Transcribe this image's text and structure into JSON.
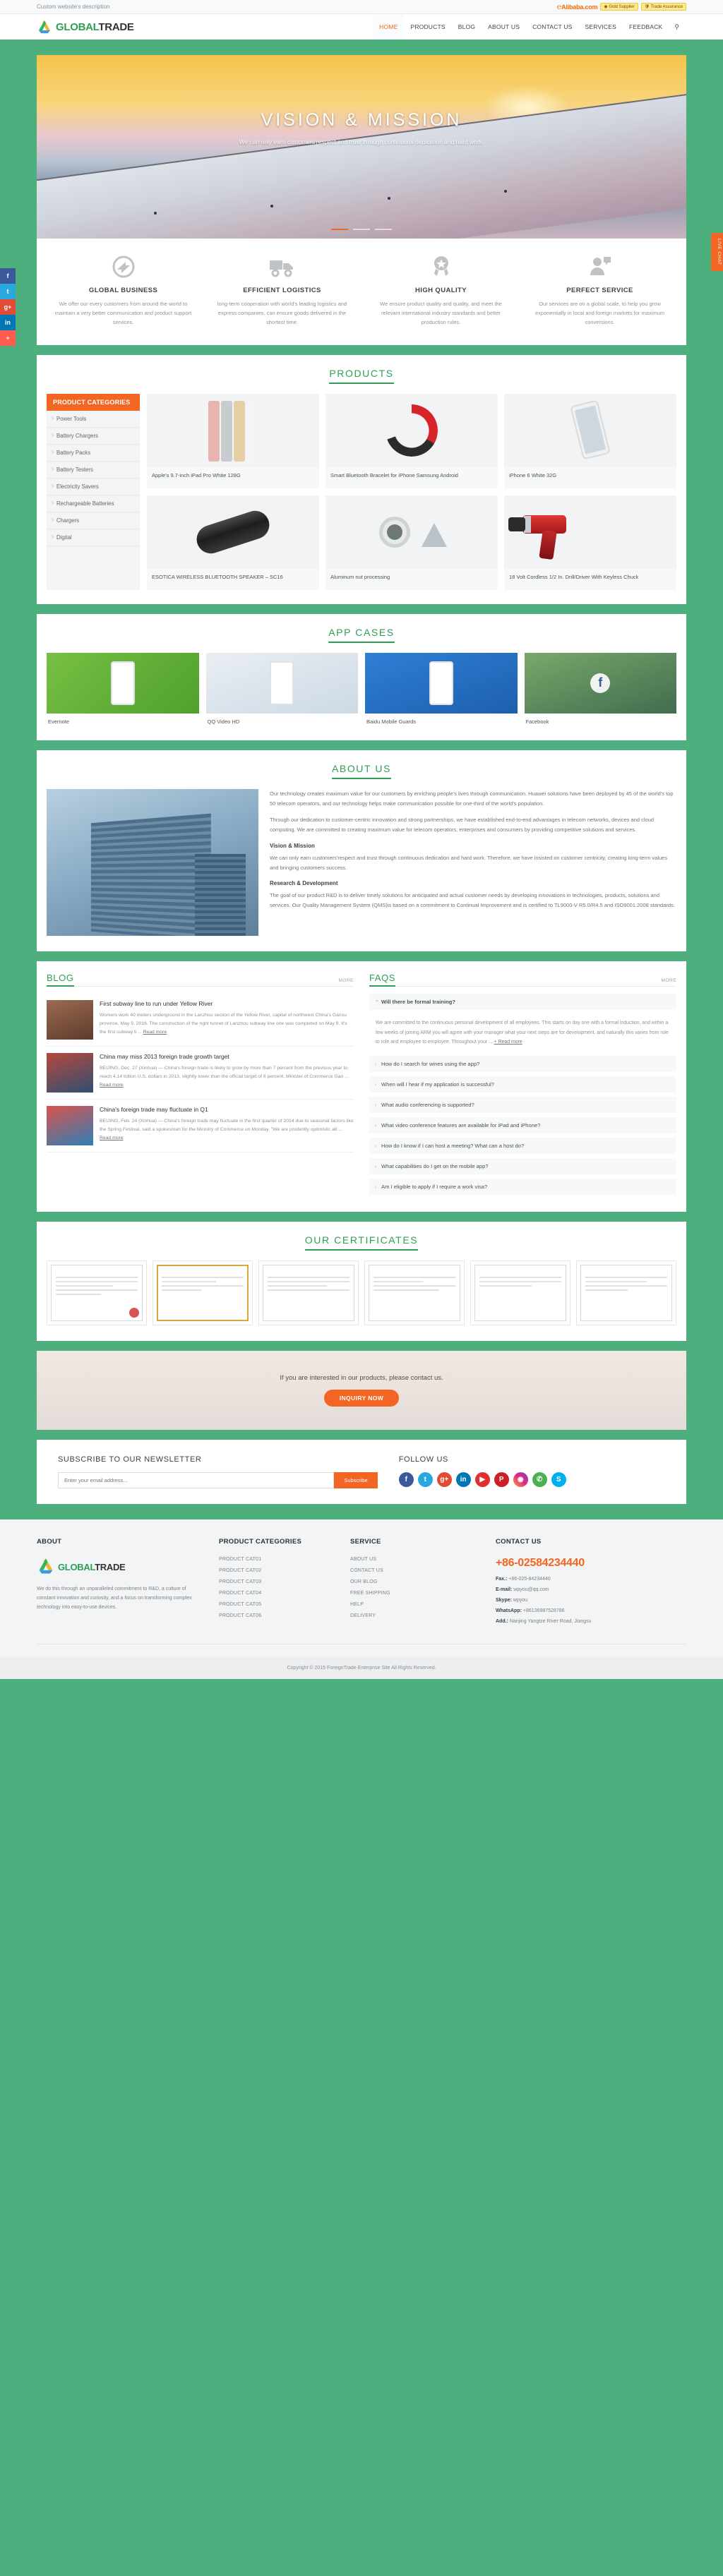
{
  "topbar": {
    "description": "Custom website's description",
    "alibaba_label": "Alibaba.com",
    "gold_supplier": "Gold Supplier",
    "trade_assurance": "Trade Assurance"
  },
  "header": {
    "logo_first": "GLOBAL",
    "logo_second": "TRADE",
    "nav": [
      {
        "label": "HOME",
        "active": true
      },
      {
        "label": "PRODUCTS",
        "active": false
      },
      {
        "label": "BLOG",
        "active": false
      },
      {
        "label": "ABOUT US",
        "active": false
      },
      {
        "label": "CONTACT US",
        "active": false
      },
      {
        "label": "SERVICES",
        "active": false
      },
      {
        "label": "FEEDBACK",
        "active": false
      }
    ],
    "search_icon": "⚲"
  },
  "social_rail": [
    {
      "name": "facebook",
      "glyph": "f"
    },
    {
      "name": "twitter",
      "glyph": "t"
    },
    {
      "name": "google-plus",
      "glyph": "g+"
    },
    {
      "name": "linkedin",
      "glyph": "in"
    },
    {
      "name": "more",
      "glyph": "+"
    }
  ],
  "live_chat": "LIVE CHAT",
  "hero": {
    "title": "VISION & MISSION",
    "subtitle": "We can only earn customers'respect and trust through continuous dedication and hard work."
  },
  "features": [
    {
      "icon": "globe-arrow-icon",
      "title": "GLOBAL BUSINESS",
      "text": "We offer our every customers from around the world to maintain a very better communication and product support services."
    },
    {
      "icon": "delivery-truck-icon",
      "title": "EFFICIENT LOGISTICS",
      "text": "long-term cooperation with world's leading logistics and express companies, can ensure goods delivered in the shortest time."
    },
    {
      "icon": "award-badge-icon",
      "title": "HIGH QUALITY",
      "text": "We ensure product quality and quality, and meet the relevant international industry standards and better production rules."
    },
    {
      "icon": "support-agent-icon",
      "title": "PERFECT SERVICE",
      "text": "Our services are on a global scale, to help you grow exponentially in local and foreign markets for maximum conversions."
    }
  ],
  "products": {
    "section_title": "PRODUCTS",
    "categories_title": "PRODUCT CATEGORIES",
    "categories": [
      "Power Tools",
      "Battery Chargers",
      "Battery Packs",
      "Battery Testers",
      "Electricity Savers",
      "Rechargeable Batteries",
      "Chargers",
      "Digital"
    ],
    "items": [
      {
        "name": "Apple's 9.7-inch iPad Pro White 128G",
        "art": "ipads"
      },
      {
        "name": "Smart Bluetooth Bracelet for iPhone Samsung Android",
        "art": "bracelet"
      },
      {
        "name": "iPhone 6 White 32G",
        "art": "iphone"
      },
      {
        "name": "ESOTICA WIRELESS BLUETOOTH SPEAKER – SC16",
        "art": "speaker"
      },
      {
        "name": "Aluminum nut processing",
        "art": "nut"
      },
      {
        "name": "18 Volt Cordless 1/2 In. Drill/Driver With Keyless Chuck",
        "art": "drill"
      }
    ]
  },
  "app_cases": {
    "section_title": "APP CASES",
    "items": [
      {
        "name": "Evernote",
        "art": "c1"
      },
      {
        "name": "QQ Video HD",
        "art": "c2"
      },
      {
        "name": "Baidu Mobile Guards",
        "art": "c3"
      },
      {
        "name": "Facebook",
        "art": "c4"
      }
    ]
  },
  "about": {
    "section_title": "ABOUT US",
    "p1": "Our technology creates maximum value for our customers by enriching people's lives through communication. Huawei solutions have been deployed by 45 of the world's top 50 telecom operators, and our technology helps make communication possible for one-third of the world's population.",
    "p2": "Through our dedication to customer-centric innovation and strong partnerships, we have established end-to-end advantages in telecom networks, devices and cloud computing. We are committed to creating maximum value for telecom operators, enterprises and consumers by providing competitive solutions and services.",
    "h1": "Vision & Mission",
    "p3": "We can only earn customers'respect and trust through continuous dedication and hard work. Therefore, we have insisted on customer centricity, creating long-term values and bringing customers success.",
    "h2": "Research & Development",
    "p4": "The goal of our product R&D is to deliver timely solutions for anticipated and actual customer needs by developing innovations in technologies, products, solutions and services. Our Quality Management System (QMS)is based on a commitment to Continual Improvement and is certified to TL9000-V R5.0/R4.5 and ISO9001:2008 standards."
  },
  "blog": {
    "title": "BLOG",
    "more": "MORE",
    "read_more": "Read more",
    "items": [
      {
        "title": "First subway line to run under Yellow River",
        "excerpt": "Workers work 40 meters underground in the Lanzhou section of the Yellow River, capital of northwest China's Gansu province, May 9, 2016. The construction of the right tunnel of Lanzhou subway line one was completed on May 9. It's the first subway li ...",
        "art": "bt1"
      },
      {
        "title": "China may miss 2013 foreign trade growth target",
        "excerpt": "BEIJING, Dec. 27 (Xinhua) — China's foreign trade is likely to grow by more than 7 percent from the previous year to reach 4.14 trillion U.S. dollars in 2013, slightly lower than the official target of 8 percent. Minister of Commerce Gao ...",
        "art": "bt2"
      },
      {
        "title": "China's foreign trade may fluctuate in Q1",
        "excerpt": "BEIJING, Feb. 24 (Xinhua) — China's foreign trade may fluctuate in the first quarter of 2014 due to seasonal factors like the Spring Festival, said a spokesman for the Ministry of Commerce on Monday. \"We are prudently optimistic ab ...",
        "art": "bt3"
      }
    ]
  },
  "faqs": {
    "title": "FAQS",
    "more": "MORE",
    "read_more": "+ Read more",
    "open_question": "Will there be formal training?",
    "open_answer": "We are committed to the continuous personal development of all employees. This starts on day one with a formal induction, and within a few weeks of joining ARM you will agree with your manager what your next steps are for development, and naturally this varies from role to role and employee to employee. Throughout your ...",
    "items": [
      "How do I search for wines using the app?",
      "When will I hear if my application is successful?",
      "What audio conferencing is supported?",
      "What video conference features are available for iPad and iPhone?",
      "How do I know if I can host a meeting? What can a host do?",
      "What capabilities do I get on the mobile app?",
      "Am I eligible to apply if I require a work visa?"
    ]
  },
  "certificates": {
    "section_title": "OUR CERTIFICATES",
    "items": [
      {
        "label": "certificate-1"
      },
      {
        "label": "certificate-2"
      },
      {
        "label": "certificate-3"
      },
      {
        "label": "certificate-4"
      },
      {
        "label": "certificate-5"
      },
      {
        "label": "certificate-6"
      }
    ]
  },
  "cta": {
    "text": "If you are interested in our products, please contact us.",
    "button": "INQUIRY NOW"
  },
  "newsletter": {
    "title": "SUBSCRIBE TO OUR NEWSLETTER",
    "placeholder": "Enter your email address...",
    "button": "Subscribe",
    "follow_title": "FOLLOW US",
    "socials": [
      {
        "name": "facebook",
        "glyph": "f",
        "cls": "s-fb"
      },
      {
        "name": "twitter",
        "glyph": "t",
        "cls": "s-tw"
      },
      {
        "name": "google-plus",
        "glyph": "g+",
        "cls": "s-gp"
      },
      {
        "name": "linkedin",
        "glyph": "in",
        "cls": "s-in"
      },
      {
        "name": "youtube",
        "glyph": "▶",
        "cls": "s-yt"
      },
      {
        "name": "pinterest",
        "glyph": "P",
        "cls": "s-pi"
      },
      {
        "name": "instagram",
        "glyph": "◉",
        "cls": "s-ig"
      },
      {
        "name": "whatsapp",
        "glyph": "✆",
        "cls": "s-wa"
      },
      {
        "name": "skype",
        "glyph": "S",
        "cls": "s-sk"
      }
    ]
  },
  "footer": {
    "about_title": "ABOUT",
    "logo_first": "GLOBAL",
    "logo_second": "TRADE",
    "about_text": "We do this through an unparalleled commitment to R&D, a culture of constant innovation and curiosity, and a focus on transforming complex technology into easy-to-use devices.",
    "cats_title": "PRODUCT CATEGORIES",
    "cats": [
      "PRODUCT CAT01",
      "PRODUCT CAT02",
      "PRODUCT CAT03",
      "PRODUCT CAT04",
      "PRODUCT CAT05",
      "PRODUCT CAT06"
    ],
    "service_title": "SERVICE",
    "services": [
      "ABOUT US",
      "CONTACT US",
      "OUR BLOG",
      "FREE SHIPPING",
      "HELP",
      "DELIVERY"
    ],
    "contact_title": "CONTACT US",
    "phone": "+86-02584234440",
    "fax_label": "Fax.:",
    "fax": "+86-025-84234440",
    "email_label": "E-mail:",
    "email": "wpyou@qq.com",
    "skype_label": "Skype:",
    "skype": "wpyou",
    "whatsapp_label": "WhatsApp:",
    "whatsapp": "+86136987528786",
    "add_label": "Add.:",
    "add": "Nanjing Yangtze River Road, Jiangsu",
    "copyright": "Copyright © 2015 ForeignTrade Enterprise Site All Rights Reserved."
  },
  "colors": {
    "brand_green": "#4caf7d",
    "accent_orange": "#f26522",
    "title_green": "#2e9e54"
  }
}
